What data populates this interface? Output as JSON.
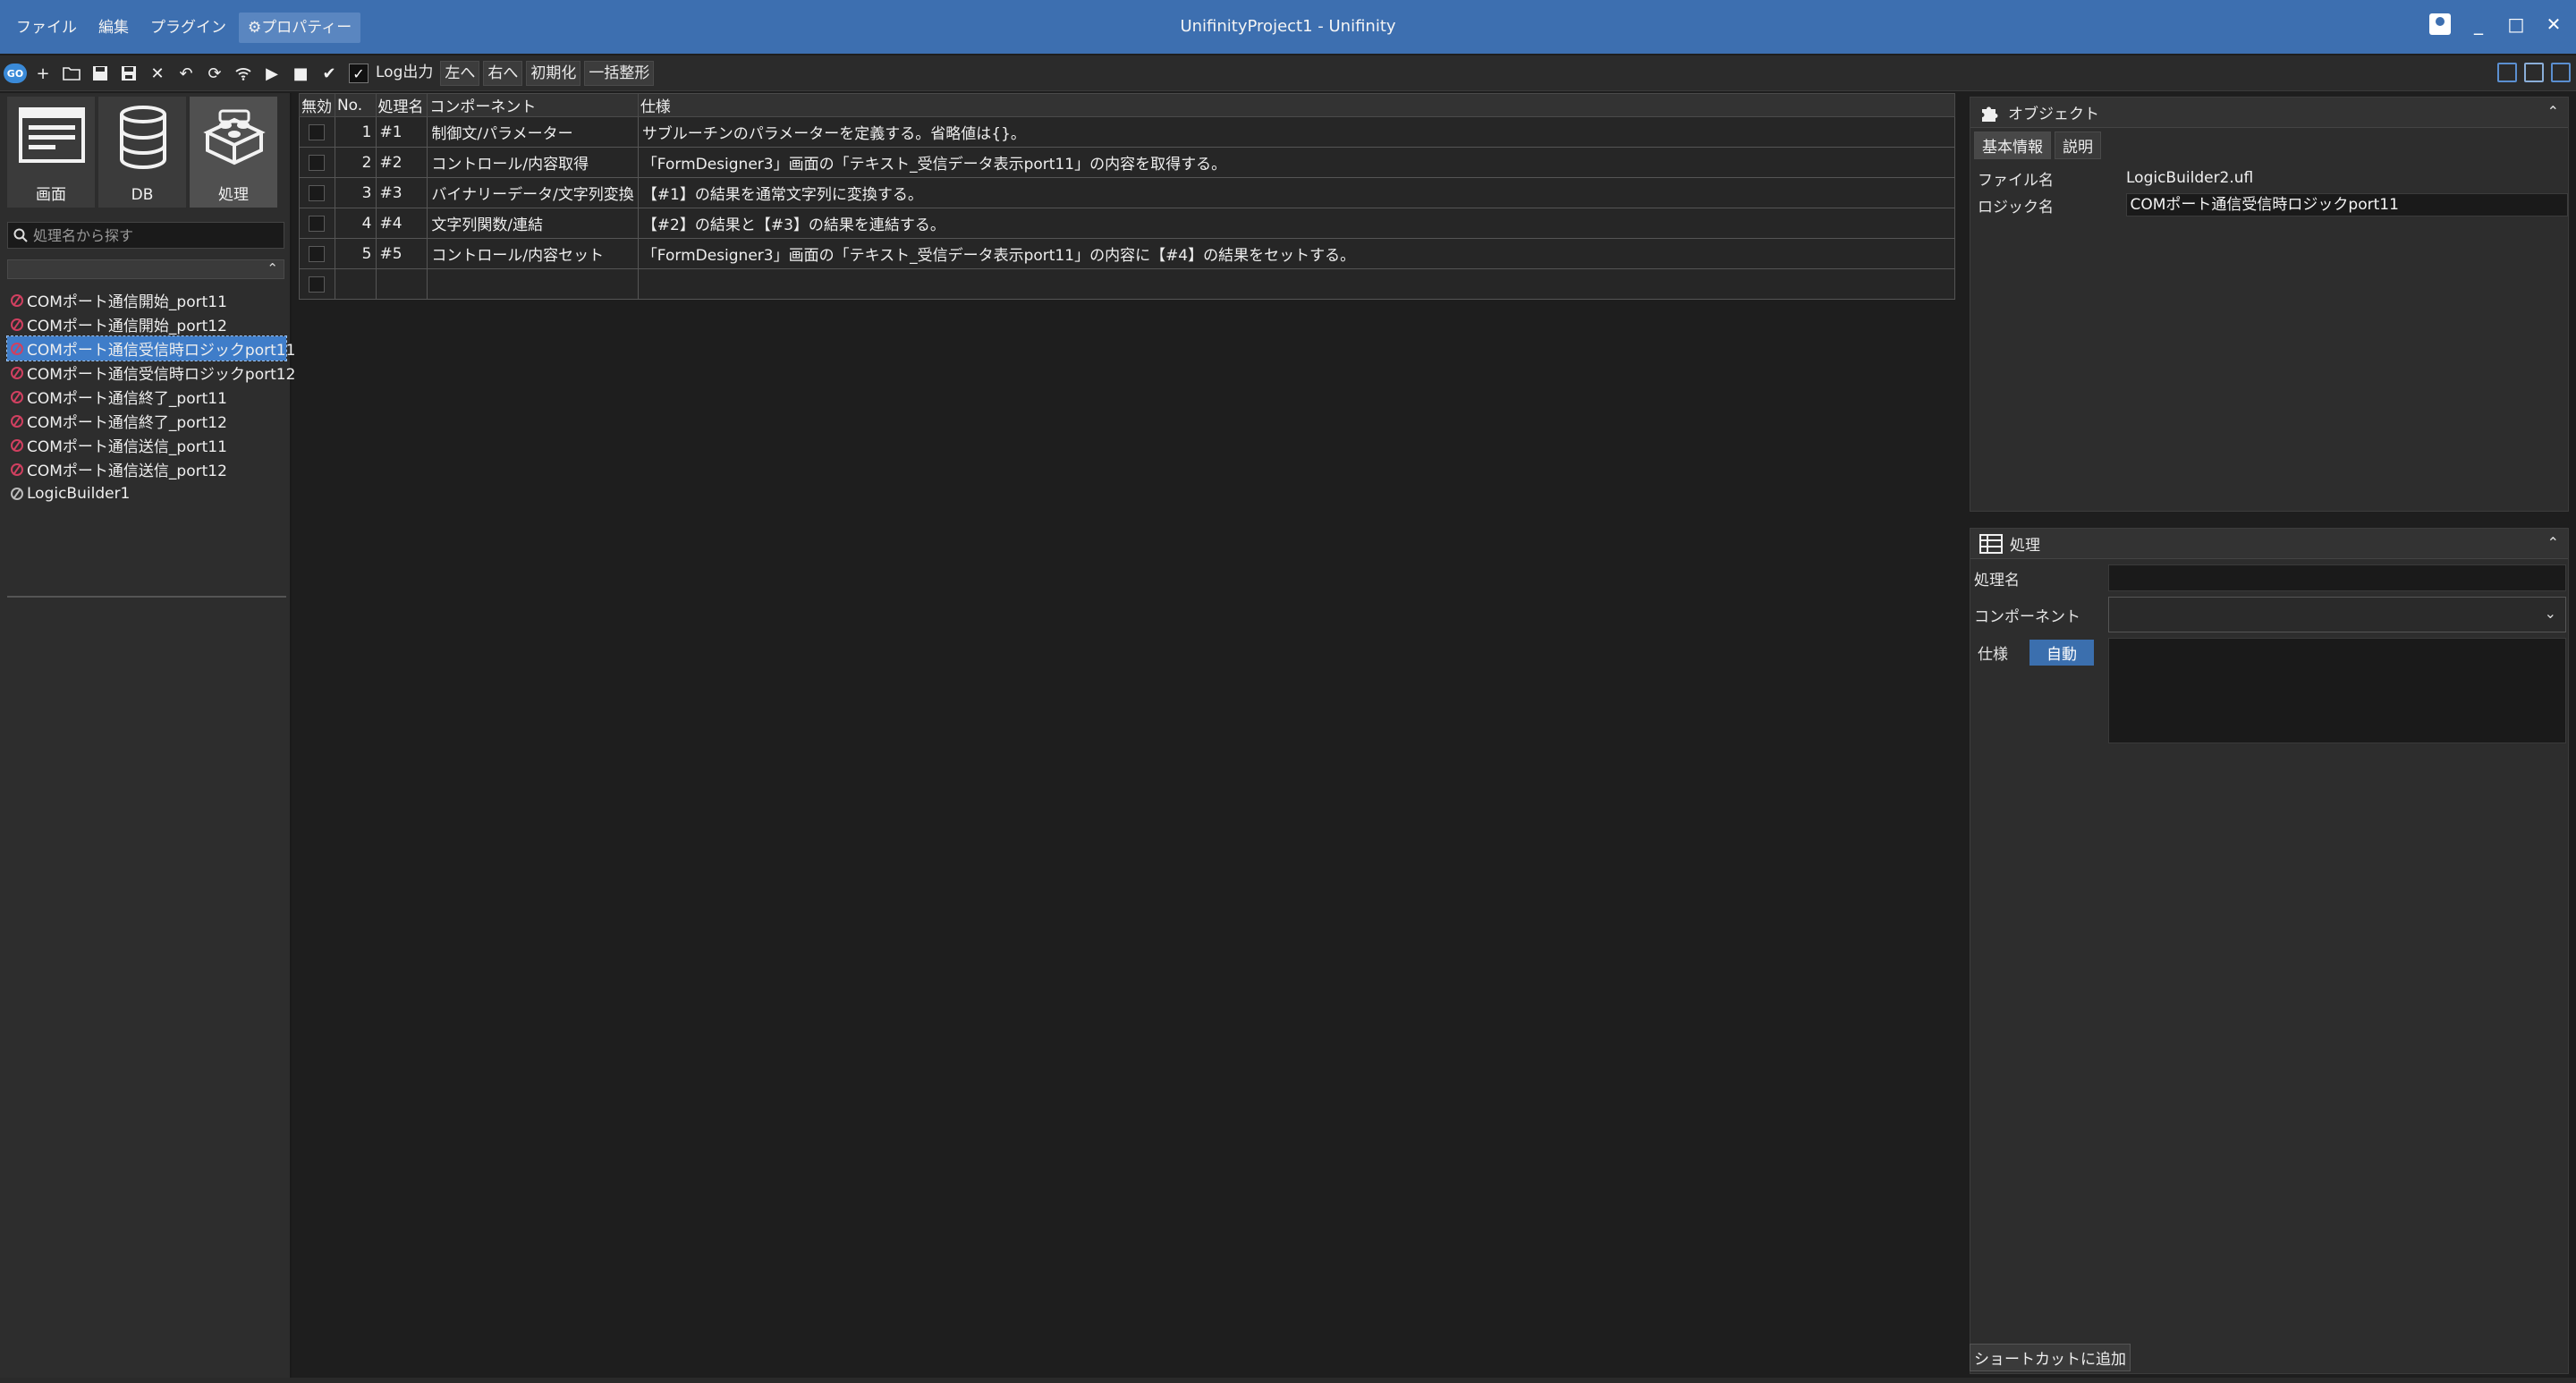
{
  "window": {
    "title": "UnifinityProject1 - Unifinity",
    "menu": [
      "ファイル",
      "編集",
      "プラグイン",
      "⚙プロパティー"
    ]
  },
  "toolbar": {
    "go_label": "GO",
    "log_label": "Log出力",
    "log_checked": true,
    "left_label": "左へ",
    "right_label": "右へ",
    "init_label": "初期化",
    "format_label": "一括整形"
  },
  "sidebar": {
    "tabs": [
      {
        "label": "画面",
        "icon": "screen-icon"
      },
      {
        "label": "DB",
        "icon": "database-icon"
      },
      {
        "label": "処理",
        "icon": "blocks-icon"
      }
    ],
    "selected_tab": "処理",
    "search_placeholder": "処理名から探す",
    "items": [
      {
        "label": "COMポート通信開始_port11",
        "selected": false
      },
      {
        "label": "COMポート通信開始_port12",
        "selected": false
      },
      {
        "label": "COMポート通信受信時ロジックport11",
        "selected": true
      },
      {
        "label": "COMポート通信受信時ロジックport12",
        "selected": false
      },
      {
        "label": "COMポート通信終了_port11",
        "selected": false
      },
      {
        "label": "COMポート通信終了_port12",
        "selected": false
      },
      {
        "label": "COMポート通信送信_port11",
        "selected": false
      },
      {
        "label": "COMポート通信送信_port12",
        "selected": false
      },
      {
        "label": "LogicBuilder1",
        "selected": false
      }
    ]
  },
  "grid": {
    "headers": [
      "無効",
      "No.",
      "処理名",
      "コンポーネント",
      "仕様"
    ],
    "rows": [
      {
        "no": "1",
        "name": "#1",
        "component": "制御文/パラメーター",
        "spec": "サブルーチンのパラメーターを定義する。省略値は{}。"
      },
      {
        "no": "2",
        "name": "#2",
        "component": "コントロール/内容取得",
        "spec": "「FormDesigner3」画面の「テキスト_受信データ表示port11」の内容を取得する。"
      },
      {
        "no": "3",
        "name": "#3",
        "component": "バイナリーデータ/文字列変換",
        "spec": "【#1】の結果を通常文字列に変換する。"
      },
      {
        "no": "4",
        "name": "#4",
        "component": "文字列関数/連結",
        "spec": "【#2】の結果と【#3】の結果を連結する。"
      },
      {
        "no": "5",
        "name": "#5",
        "component": "コントロール/内容セット",
        "spec": "「FormDesigner3」画面の「テキスト_受信データ表示port11」の内容に【#4】の結果をセットする。"
      },
      {
        "no": "",
        "name": "",
        "component": "",
        "spec": ""
      }
    ]
  },
  "object_panel": {
    "title": "オブジェクト",
    "tabs": [
      "基本情報",
      "説明"
    ],
    "file_label": "ファイル名",
    "file_value": "LogicBuilder2.ufl",
    "logic_label": "ロジック名",
    "logic_value": "COMポート通信受信時ロジックport11"
  },
  "process_panel": {
    "title": "処理",
    "name_label": "処理名",
    "name_value": "",
    "component_label": "コンポーネント",
    "component_value": "",
    "spec_label": "仕様",
    "auto_label": "自動",
    "spec_value": ""
  },
  "shortcut_label": "ショートカットに追加",
  "colors": {
    "titlebar": "#3d6fb0",
    "selection": "#3f7dc9",
    "accent_button": "#3b6fae"
  }
}
